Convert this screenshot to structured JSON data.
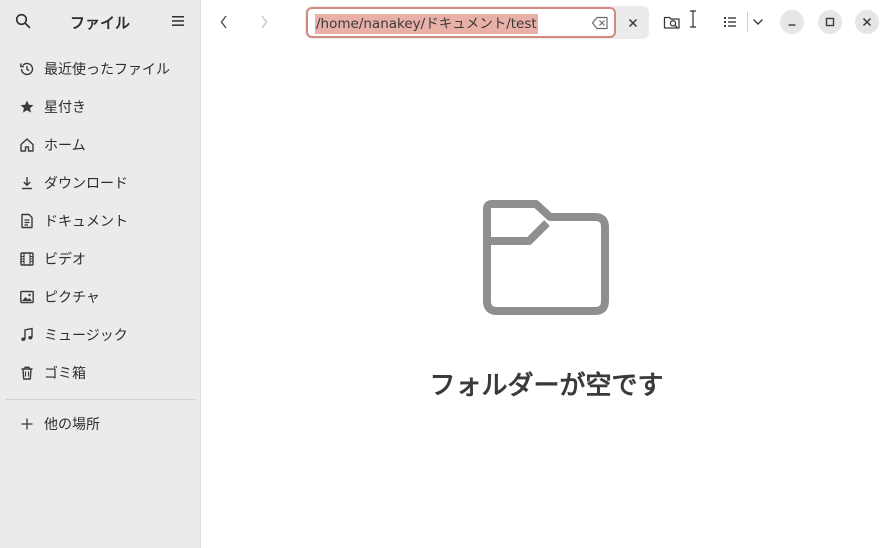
{
  "sidebar": {
    "title": "ファイル",
    "items": [
      {
        "label": "最近使ったファイル",
        "icon": "clock-icon"
      },
      {
        "label": "星付き",
        "icon": "star-icon"
      },
      {
        "label": "ホーム",
        "icon": "home-icon"
      },
      {
        "label": "ダウンロード",
        "icon": "download-icon"
      },
      {
        "label": "ドキュメント",
        "icon": "document-icon"
      },
      {
        "label": "ビデオ",
        "icon": "video-icon"
      },
      {
        "label": "ピクチャ",
        "icon": "picture-icon"
      },
      {
        "label": "ミュージック",
        "icon": "music-icon"
      },
      {
        "label": "ゴミ箱",
        "icon": "trash-icon"
      }
    ],
    "other_locations": "他の場所"
  },
  "toolbar": {
    "path_value": "/home/nanakey/ドキュメント/test"
  },
  "main": {
    "empty_message": "フォルダーが空です"
  },
  "colors": {
    "sidebar_bg": "#ebebeb",
    "selection": "#e8b0a6",
    "entry_border": "#d08b7d"
  }
}
